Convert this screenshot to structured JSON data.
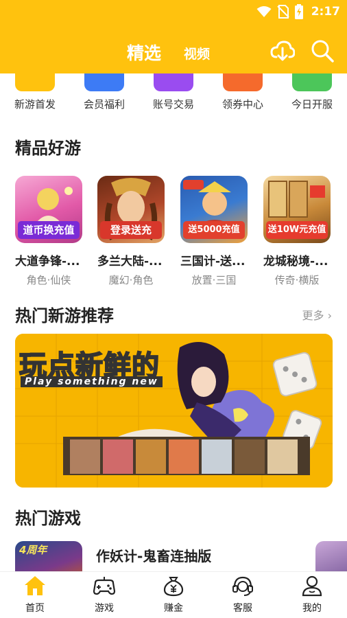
{
  "status_bar": {
    "time": "2:17"
  },
  "header": {
    "tab_active": "精选",
    "tab_inactive": "视频",
    "download_icon": "cloud-download-icon",
    "search_icon": "search-icon"
  },
  "colors": {
    "brand": "#FFC20E",
    "text_primary": "#222222",
    "text_muted": "#888888"
  },
  "quick_entries": [
    {
      "label": "新游首发",
      "icon": "gamepad-icon",
      "color": "#FFC20E"
    },
    {
      "label": "会员福利",
      "icon": "vip-icon",
      "color": "#3D7BF5"
    },
    {
      "label": "账号交易",
      "icon": "trade-icon",
      "color": "#9A4CF0"
    },
    {
      "label": "领券中心",
      "icon": "coupon-icon",
      "color": "#F56A2C"
    },
    {
      "label": "今日开服",
      "icon": "server-icon",
      "color": "#4CC65A"
    }
  ],
  "featured": {
    "title": "精品好游",
    "games": [
      {
        "name": "大道争锋-...",
        "tags": "角色·仙侠",
        "banner": "道币换充值",
        "bg": "#E25AA8",
        "banner_bg": "#7A2BD6"
      },
      {
        "name": "多兰大陆-...",
        "tags": "魔幻·角色",
        "banner": "登录送充",
        "bg": "#B0472A",
        "banner_bg": "#D8372B"
      },
      {
        "name": "三国计-送...",
        "tags": "放置·三国",
        "banner": "送5000充值",
        "bg": "#3A7BD1",
        "banner_bg": "#E2402D"
      },
      {
        "name": "龙城秘境-...",
        "tags": "传奇·横版",
        "banner": "送10W元充值",
        "bg": "#C98A3A",
        "banner_bg": "#E63B2E"
      }
    ]
  },
  "new_games": {
    "title": "热门新游推荐",
    "more_label": "更多",
    "banner_title": "玩点新鲜的",
    "banner_subtitle": "Play something new"
  },
  "hot_games": {
    "title": "热门游戏",
    "first_item_name": "作妖计-鬼畜连抽版",
    "first_item_badge": "4周年"
  },
  "bottom_nav": [
    {
      "label": "首页",
      "icon": "home-icon",
      "active": true
    },
    {
      "label": "游戏",
      "icon": "gamepad-icon",
      "active": false
    },
    {
      "label": "赚金",
      "icon": "money-bag-icon",
      "active": false
    },
    {
      "label": "客服",
      "icon": "headset-icon",
      "active": false
    },
    {
      "label": "我的",
      "icon": "profile-icon",
      "active": false
    }
  ]
}
